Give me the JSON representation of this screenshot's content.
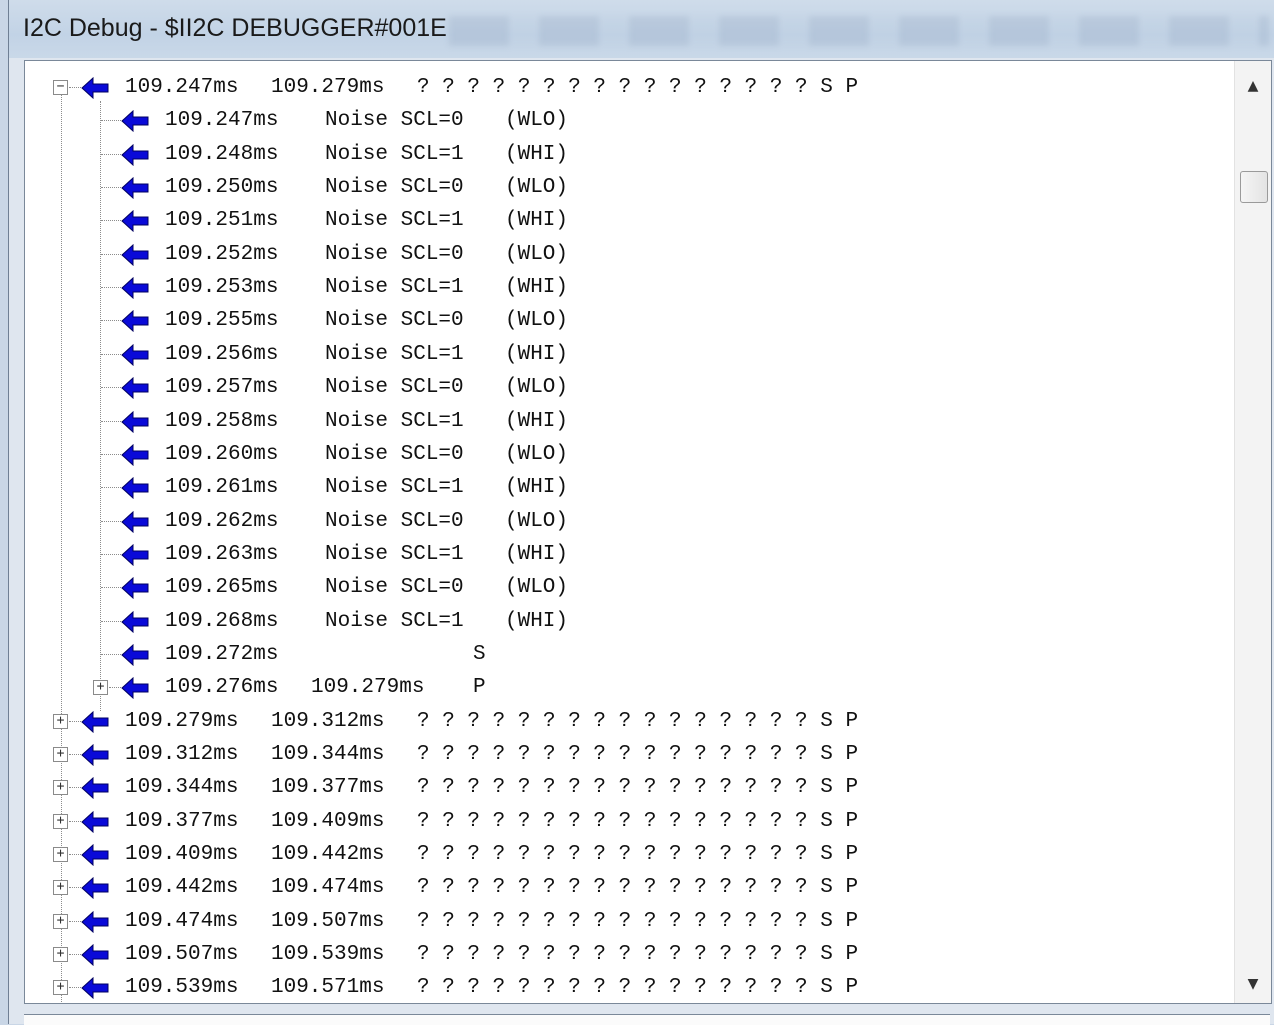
{
  "window": {
    "title": "I2C Debug - $II2C DEBUGGER#001E"
  },
  "tree": {
    "rows": [
      {
        "level": 0,
        "expander": "minus",
        "c1": "109.247ms",
        "c2": "109.279ms",
        "c3": "? ? ? ? ? ? ? ? ? ? ? ? ? ? ? ? S P"
      },
      {
        "level": 1,
        "c1": "109.247ms",
        "c2": "Noise SCL=0",
        "c3": "(WLO)"
      },
      {
        "level": 1,
        "c1": "109.248ms",
        "c2": "Noise SCL=1",
        "c3": "(WHI)"
      },
      {
        "level": 1,
        "c1": "109.250ms",
        "c2": "Noise SCL=0",
        "c3": "(WLO)"
      },
      {
        "level": 1,
        "c1": "109.251ms",
        "c2": "Noise SCL=1",
        "c3": "(WHI)"
      },
      {
        "level": 1,
        "c1": "109.252ms",
        "c2": "Noise SCL=0",
        "c3": "(WLO)"
      },
      {
        "level": 1,
        "c1": "109.253ms",
        "c2": "Noise SCL=1",
        "c3": "(WHI)"
      },
      {
        "level": 1,
        "c1": "109.255ms",
        "c2": "Noise SCL=0",
        "c3": "(WLO)"
      },
      {
        "level": 1,
        "c1": "109.256ms",
        "c2": "Noise SCL=1",
        "c3": "(WHI)"
      },
      {
        "level": 1,
        "c1": "109.257ms",
        "c2": "Noise SCL=0",
        "c3": "(WLO)"
      },
      {
        "level": 1,
        "c1": "109.258ms",
        "c2": "Noise SCL=1",
        "c3": "(WHI)"
      },
      {
        "level": 1,
        "c1": "109.260ms",
        "c2": "Noise SCL=0",
        "c3": "(WLO)"
      },
      {
        "level": 1,
        "c1": "109.261ms",
        "c2": "Noise SCL=1",
        "c3": "(WHI)"
      },
      {
        "level": 1,
        "c1": "109.262ms",
        "c2": "Noise SCL=0",
        "c3": "(WLO)"
      },
      {
        "level": 1,
        "c1": "109.263ms",
        "c2": "Noise SCL=1",
        "c3": "(WHI)"
      },
      {
        "level": 1,
        "c1": "109.265ms",
        "c2": "Noise SCL=0",
        "c3": "(WLO)"
      },
      {
        "level": 1,
        "c1": "109.268ms",
        "c2": "Noise SCL=1",
        "c3": "(WHI)"
      },
      {
        "level": 1,
        "c1": "109.272ms",
        "c2": "",
        "c3": "S"
      },
      {
        "level": 1,
        "expander": "plus",
        "c1": "109.276ms",
        "c2": "109.279ms",
        "c3": "P"
      },
      {
        "level": 0,
        "expander": "plus",
        "c1": "109.279ms",
        "c2": "109.312ms",
        "c3": "? ? ? ? ? ? ? ? ? ? ? ? ? ? ? ? S P"
      },
      {
        "level": 0,
        "expander": "plus",
        "c1": "109.312ms",
        "c2": "109.344ms",
        "c3": "? ? ? ? ? ? ? ? ? ? ? ? ? ? ? ? S P"
      },
      {
        "level": 0,
        "expander": "plus",
        "c1": "109.344ms",
        "c2": "109.377ms",
        "c3": "? ? ? ? ? ? ? ? ? ? ? ? ? ? ? ? S P"
      },
      {
        "level": 0,
        "expander": "plus",
        "c1": "109.377ms",
        "c2": "109.409ms",
        "c3": "? ? ? ? ? ? ? ? ? ? ? ? ? ? ? ? S P"
      },
      {
        "level": 0,
        "expander": "plus",
        "c1": "109.409ms",
        "c2": "109.442ms",
        "c3": "? ? ? ? ? ? ? ? ? ? ? ? ? ? ? ? S P"
      },
      {
        "level": 0,
        "expander": "plus",
        "c1": "109.442ms",
        "c2": "109.474ms",
        "c3": "? ? ? ? ? ? ? ? ? ? ? ? ? ? ? ? S P"
      },
      {
        "level": 0,
        "expander": "plus",
        "c1": "109.474ms",
        "c2": "109.507ms",
        "c3": "? ? ? ? ? ? ? ? ? ? ? ? ? ? ? ? S P"
      },
      {
        "level": 0,
        "expander": "plus",
        "c1": "109.507ms",
        "c2": "109.539ms",
        "c3": "? ? ? ? ? ? ? ? ? ? ? ? ? ? ? ? S P"
      },
      {
        "level": 0,
        "expander": "plus",
        "c1": "109.539ms",
        "c2": "109.571ms",
        "c3": "? ? ? ? ? ? ? ? ? ? ? ? ? ? ? ? S P"
      }
    ]
  },
  "icons": {
    "node_icon": "left-arrow-icon",
    "arrow_color": "#0a0ad8",
    "scroll_up": "▲",
    "scroll_down": "▼",
    "expand": "+",
    "collapse": "−"
  }
}
